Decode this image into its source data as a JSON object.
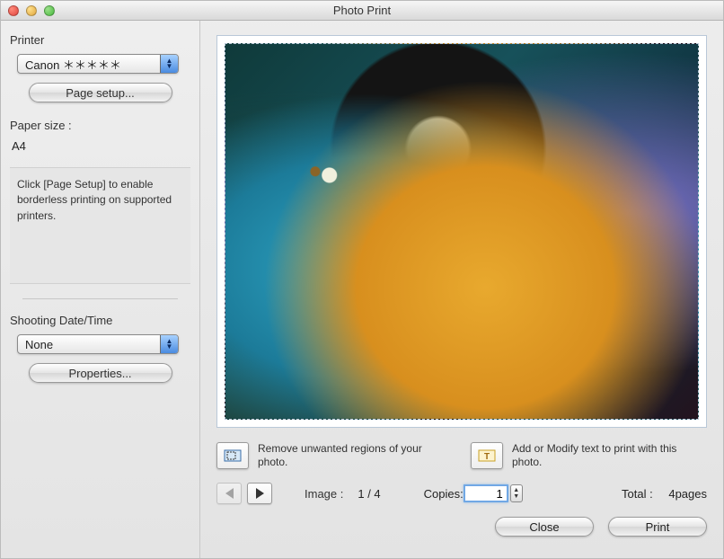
{
  "window": {
    "title": "Photo Print"
  },
  "sidebar": {
    "printer_label": "Printer",
    "printer_select": "Canon ＊＊＊＊＊",
    "page_setup_btn": "Page setup...",
    "paper_size_label": "Paper size :",
    "paper_size_value": "A4",
    "hint_text": "Click [Page Setup] to enable borderless printing on supported printers.",
    "datetime_label": "Shooting Date/Time",
    "datetime_select": "None",
    "properties_btn": "Properties..."
  },
  "tools": {
    "crop_text": "Remove unwanted regions of your photo.",
    "text_tool_text": "Add or Modify text to print with this photo."
  },
  "nav": {
    "image_label": "Image :",
    "image_counter": "1 / 4",
    "copies_label": "Copies:",
    "copies_value": "1",
    "total_label": "Total :",
    "total_value": "4pages"
  },
  "footer": {
    "close": "Close",
    "print": "Print"
  }
}
